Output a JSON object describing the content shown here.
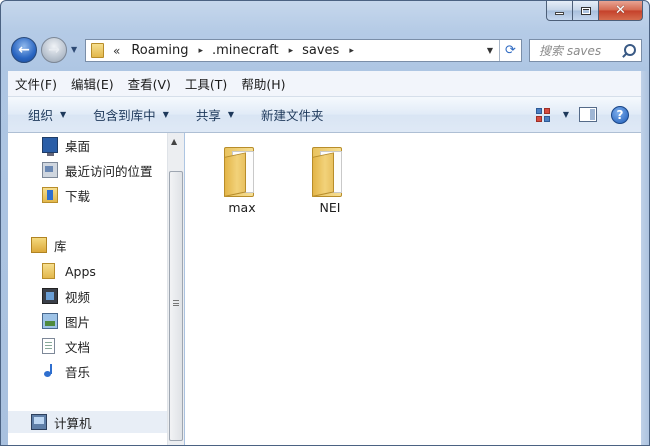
{
  "window": {
    "caption_buttons": {
      "minimize": "–",
      "maximize": "□",
      "close": "✕"
    }
  },
  "navigation": {
    "back_icon": "arrow-left-icon",
    "forward_icon": "arrow-right-icon",
    "address": {
      "overflow": "«",
      "crumbs": [
        "Roaming",
        ".minecraft",
        "saves"
      ],
      "separator": "▸"
    },
    "search": {
      "placeholder": "搜索 saves"
    }
  },
  "menu": {
    "items": [
      "文件(F)",
      "编辑(E)",
      "查看(V)",
      "工具(T)",
      "帮助(H)"
    ]
  },
  "commands": {
    "organize": "组织",
    "include_in_library": "包含到库中",
    "share": "共享",
    "new_folder": "新建文件夹",
    "dropdown_arrow": "▼",
    "help": "?"
  },
  "sidebar": {
    "favorites": [
      {
        "label": "桌面",
        "icon": "desktop-icon"
      },
      {
        "label": "最近访问的位置",
        "icon": "recent-places-icon"
      },
      {
        "label": "下载",
        "icon": "downloads-icon"
      }
    ],
    "libraries": {
      "label": "库",
      "icon": "library-icon",
      "items": [
        {
          "label": "Apps",
          "icon": "folder-icon"
        },
        {
          "label": "视频",
          "icon": "video-icon"
        },
        {
          "label": "图片",
          "icon": "picture-icon"
        },
        {
          "label": "文档",
          "icon": "document-icon"
        },
        {
          "label": "音乐",
          "icon": "music-icon"
        }
      ]
    },
    "computer": {
      "label": "计算机",
      "icon": "computer-icon"
    }
  },
  "files": [
    {
      "name": "max",
      "icon": "folder-icon"
    },
    {
      "name": "NEI",
      "icon": "folder-icon"
    }
  ],
  "colors": {
    "frame": "#a9c1df",
    "accent": "#2a66c2",
    "folder": "#e2b74c"
  }
}
